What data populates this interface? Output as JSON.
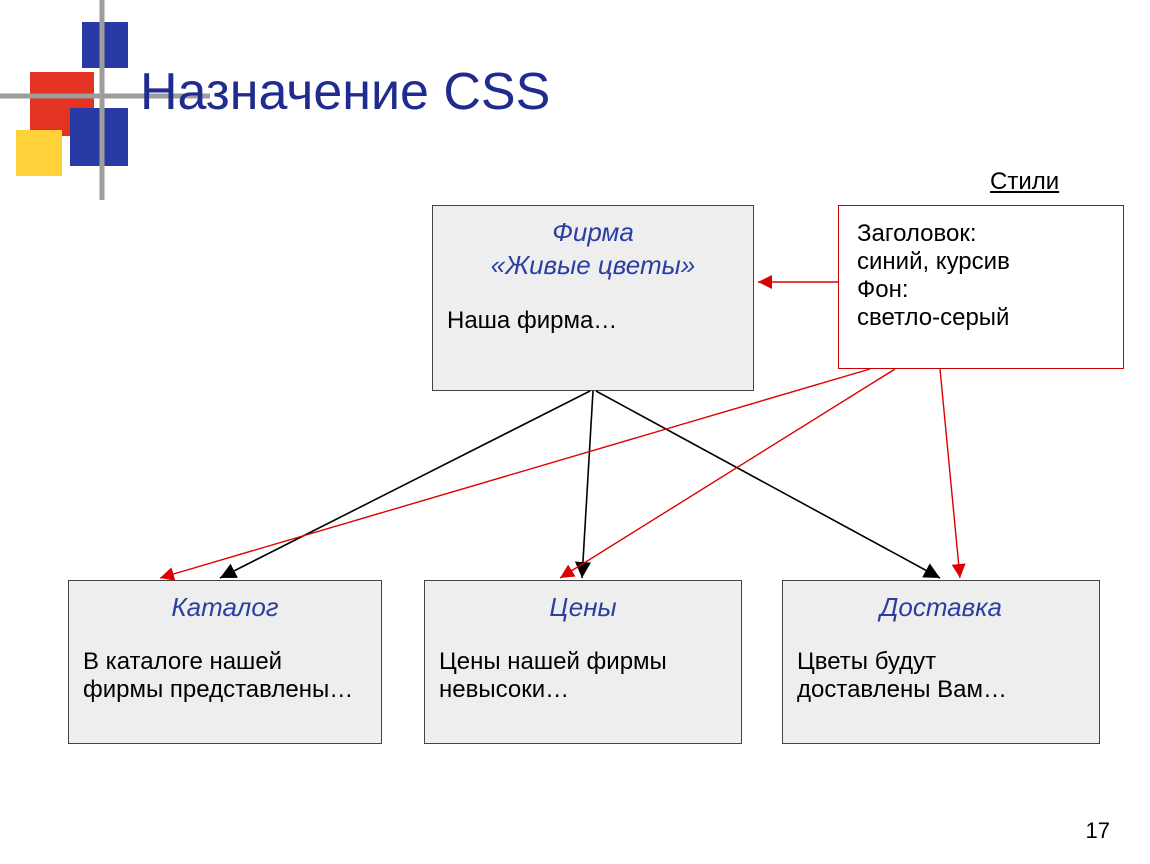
{
  "title": "Назначение CSS",
  "slide_number": "17",
  "styles_caption": "Стили",
  "styles_box": {
    "l1": "Заголовок:",
    "l2": "синий, курсив",
    "l3": "Фон:",
    "l4": "светло-серый"
  },
  "main_box": {
    "header_l1": "Фирма",
    "header_l2": "«Живые цветы»",
    "body": "Наша фирма…"
  },
  "children": [
    {
      "header": "Каталог",
      "body_l1": "В каталоге нашей",
      "body_l2": "фирмы представлены…"
    },
    {
      "header": "Цены",
      "body_l1": "Цены нашей фирмы",
      "body_l2": "невысоки…"
    },
    {
      "header": "Доставка",
      "body_l1": "Цветы будут",
      "body_l2": "доставлены Вам…"
    }
  ]
}
